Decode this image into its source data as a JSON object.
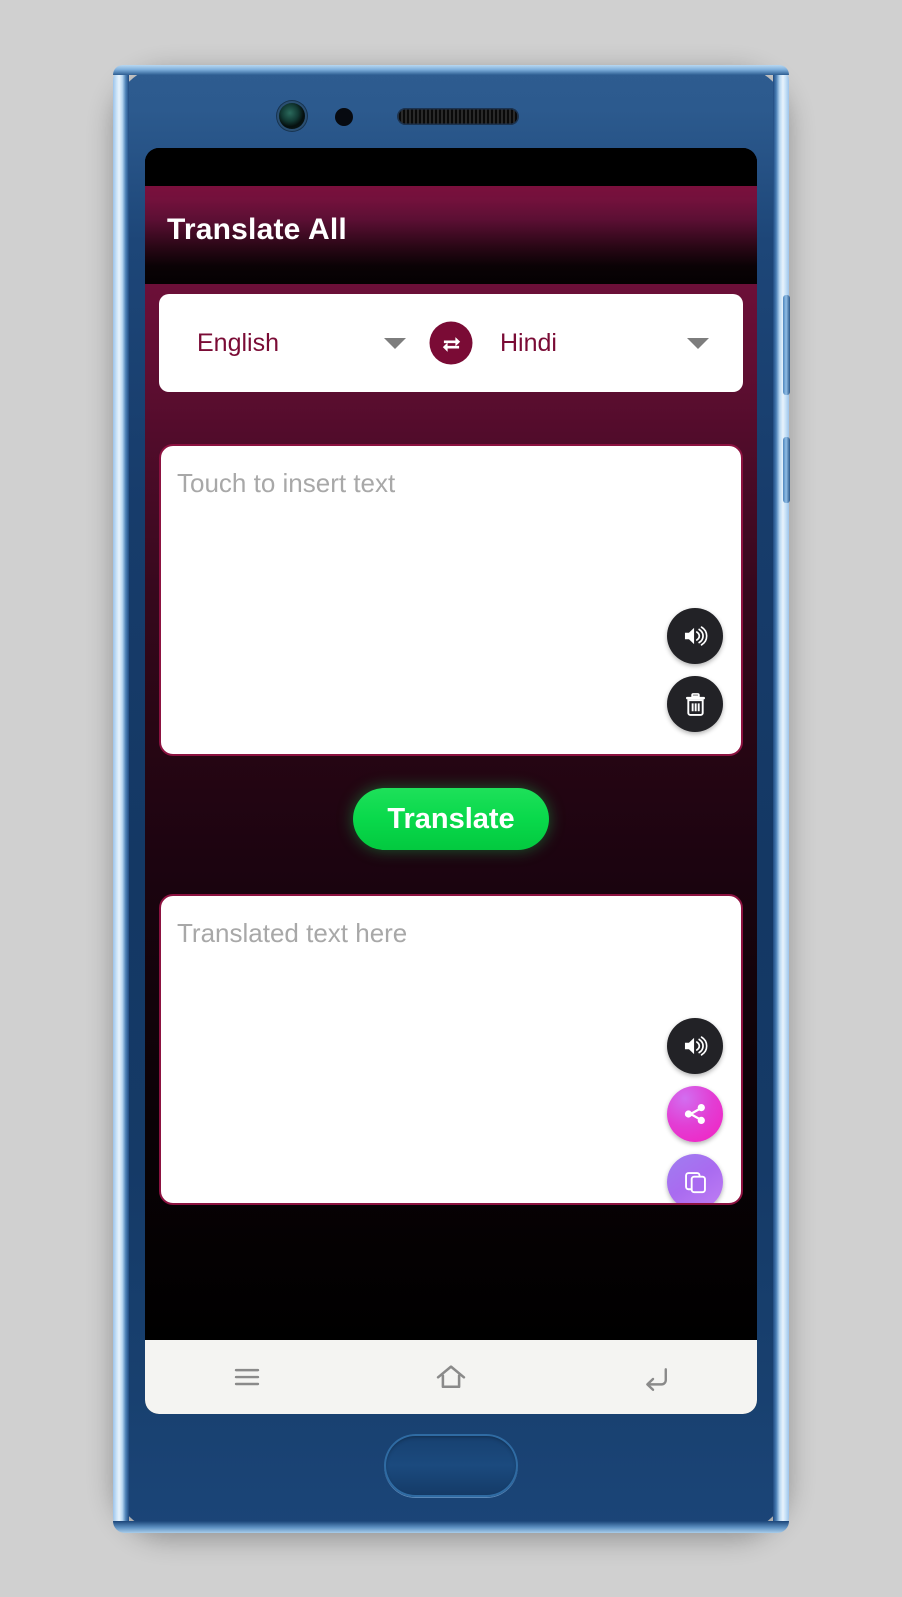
{
  "app": {
    "title": "Translate All",
    "theme": {
      "app_bar_maroon": "#7a0f3c",
      "accent_maroon": "#7a0b35",
      "translate_green": "#09d94b",
      "share_magenta": "#f41fc0",
      "copy_purple": "#a96bf0",
      "panel_border": "#8c1240",
      "device_blue": "#173c6b"
    }
  },
  "language_bar": {
    "source": {
      "label": "English",
      "caret_icon": "chevron-down-icon"
    },
    "target": {
      "label": "Hindi",
      "caret_icon": "chevron-down-icon"
    },
    "swap_icon": "swap-horizontal-icon"
  },
  "input_panel": {
    "placeholder": "Touch to insert text",
    "value": "",
    "actions": [
      {
        "name": "speak-input-button",
        "icon": "speaker-icon"
      },
      {
        "name": "clear-input-button",
        "icon": "trash-icon"
      }
    ]
  },
  "translate": {
    "label": "Translate"
  },
  "output_panel": {
    "placeholder": "Translated text here",
    "value": "",
    "actions": [
      {
        "name": "speak-output-button",
        "icon": "speaker-icon"
      },
      {
        "name": "share-output-button",
        "icon": "share-icon"
      },
      {
        "name": "copy-output-button",
        "icon": "copy-icon"
      }
    ]
  },
  "nav_bar": {
    "buttons": [
      {
        "name": "recents-button",
        "icon": "hamburger-menu-icon"
      },
      {
        "name": "home-button",
        "icon": "home-icon"
      },
      {
        "name": "back-button",
        "icon": "back-arrow-icon"
      }
    ]
  },
  "device": {
    "hardware": [
      {
        "name": "front-camera",
        "icon": "camera-icon"
      },
      {
        "name": "proximity-sensor",
        "icon": "sensor-dot-icon"
      },
      {
        "name": "earpiece-speaker",
        "icon": "speaker-grille-icon"
      },
      {
        "name": "home-hardware-button",
        "icon": "home-pill-icon"
      },
      {
        "name": "side-button-volume",
        "icon": "volume-rocker-icon"
      },
      {
        "name": "side-button-power",
        "icon": "power-button-icon"
      }
    ]
  }
}
